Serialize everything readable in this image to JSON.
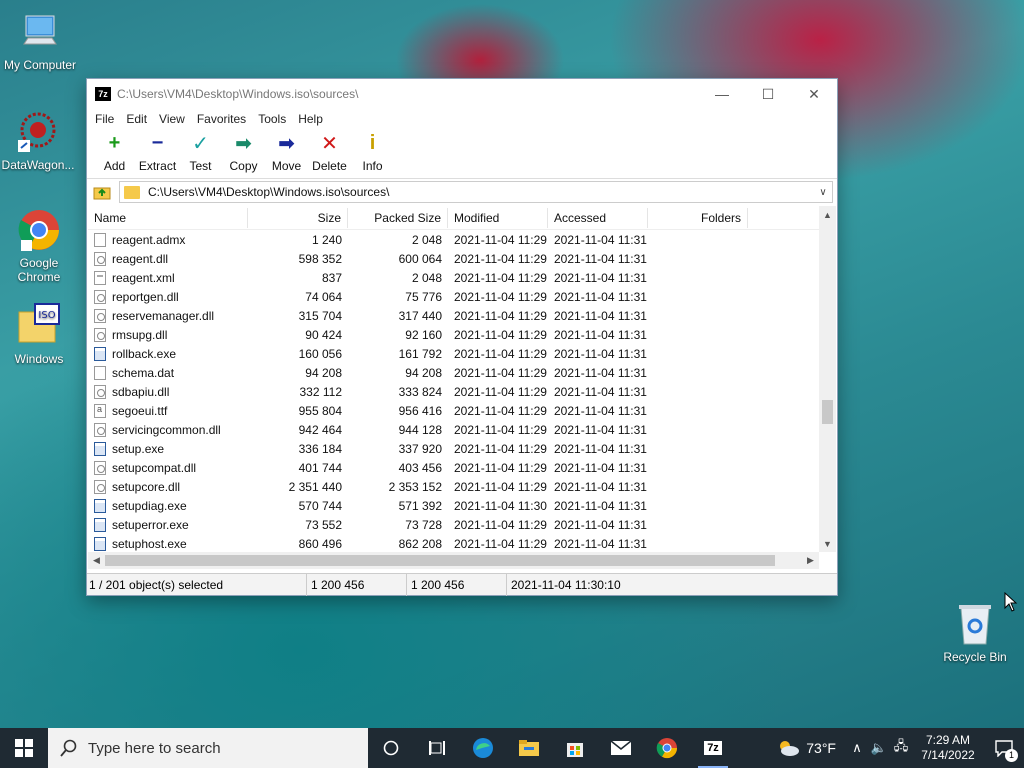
{
  "desktop": {
    "icons": [
      {
        "label": "My Computer"
      },
      {
        "label": "DataWagon..."
      },
      {
        "label": "Google Chrome"
      },
      {
        "label": "Windows"
      },
      {
        "label": "Recycle Bin"
      }
    ]
  },
  "window": {
    "title": "C:\\Users\\VM4\\Desktop\\Windows.iso\\sources\\",
    "app_icon_text": "7z",
    "menu": [
      "File",
      "Edit",
      "View",
      "Favorites",
      "Tools",
      "Help"
    ],
    "toolbar": [
      {
        "label": "Add",
        "icon": "plus-icon",
        "glyph": "+",
        "color": "#1a9a1a"
      },
      {
        "label": "Extract",
        "icon": "minus-icon",
        "glyph": "−",
        "color": "#1a2a9a"
      },
      {
        "label": "Test",
        "icon": "check-icon",
        "glyph": "✓",
        "color": "#1aa0a0"
      },
      {
        "label": "Copy",
        "icon": "copy-arrow-icon",
        "glyph": "➡",
        "color": "#1a8a6a"
      },
      {
        "label": "Move",
        "icon": "move-arrow-icon",
        "glyph": "➡",
        "color": "#1a2a9a"
      },
      {
        "label": "Delete",
        "icon": "delete-x-icon",
        "glyph": "✕",
        "color": "#d01818"
      },
      {
        "label": "Info",
        "icon": "info-icon",
        "glyph": "i",
        "color": "#c8a000"
      }
    ],
    "address": "C:\\Users\\VM4\\Desktop\\Windows.iso\\sources\\",
    "columns": [
      "Name",
      "Size",
      "Packed Size",
      "Modified",
      "Accessed",
      "Folders"
    ],
    "rows": [
      {
        "name": "reagent.admx",
        "type": "file",
        "size": "1 240",
        "packed": "2 048",
        "modified": "2021-11-04 11:29",
        "accessed": "2021-11-04 11:31"
      },
      {
        "name": "reagent.dll",
        "type": "dll",
        "size": "598 352",
        "packed": "600 064",
        "modified": "2021-11-04 11:29",
        "accessed": "2021-11-04 11:31"
      },
      {
        "name": "reagent.xml",
        "type": "xml",
        "size": "837",
        "packed": "2 048",
        "modified": "2021-11-04 11:29",
        "accessed": "2021-11-04 11:31"
      },
      {
        "name": "reportgen.dll",
        "type": "dll",
        "size": "74 064",
        "packed": "75 776",
        "modified": "2021-11-04 11:29",
        "accessed": "2021-11-04 11:31"
      },
      {
        "name": "reservemanager.dll",
        "type": "dll",
        "size": "315 704",
        "packed": "317 440",
        "modified": "2021-11-04 11:29",
        "accessed": "2021-11-04 11:31"
      },
      {
        "name": "rmsupg.dll",
        "type": "dll",
        "size": "90 424",
        "packed": "92 160",
        "modified": "2021-11-04 11:29",
        "accessed": "2021-11-04 11:31"
      },
      {
        "name": "rollback.exe",
        "type": "exe",
        "size": "160 056",
        "packed": "161 792",
        "modified": "2021-11-04 11:29",
        "accessed": "2021-11-04 11:31"
      },
      {
        "name": "schema.dat",
        "type": "file",
        "size": "94 208",
        "packed": "94 208",
        "modified": "2021-11-04 11:29",
        "accessed": "2021-11-04 11:31"
      },
      {
        "name": "sdbapiu.dll",
        "type": "dll",
        "size": "332 112",
        "packed": "333 824",
        "modified": "2021-11-04 11:29",
        "accessed": "2021-11-04 11:31"
      },
      {
        "name": "segoeui.ttf",
        "type": "ttf",
        "size": "955 804",
        "packed": "956 416",
        "modified": "2021-11-04 11:29",
        "accessed": "2021-11-04 11:31"
      },
      {
        "name": "servicingcommon.dll",
        "type": "dll",
        "size": "942 464",
        "packed": "944 128",
        "modified": "2021-11-04 11:29",
        "accessed": "2021-11-04 11:31"
      },
      {
        "name": "setup.exe",
        "type": "exe",
        "size": "336 184",
        "packed": "337 920",
        "modified": "2021-11-04 11:29",
        "accessed": "2021-11-04 11:31"
      },
      {
        "name": "setupcompat.dll",
        "type": "dll",
        "size": "401 744",
        "packed": "403 456",
        "modified": "2021-11-04 11:29",
        "accessed": "2021-11-04 11:31"
      },
      {
        "name": "setupcore.dll",
        "type": "dll",
        "size": "2 351 440",
        "packed": "2 353 152",
        "modified": "2021-11-04 11:29",
        "accessed": "2021-11-04 11:31"
      },
      {
        "name": "setupdiag.exe",
        "type": "exe",
        "size": "570 744",
        "packed": "571 392",
        "modified": "2021-11-04 11:30",
        "accessed": "2021-11-04 11:31"
      },
      {
        "name": "setuperror.exe",
        "type": "exe",
        "size": "73 552",
        "packed": "73 728",
        "modified": "2021-11-04 11:29",
        "accessed": "2021-11-04 11:31"
      },
      {
        "name": "setuphost.exe",
        "type": "exe",
        "size": "860 496",
        "packed": "862 208",
        "modified": "2021-11-04 11:29",
        "accessed": "2021-11-04 11:31"
      }
    ],
    "status": {
      "selection": "1 / 201 object(s) selected",
      "size": "1 200 456",
      "packed": "1 200 456",
      "modified": "2021-11-04 11:30:10"
    }
  },
  "taskbar": {
    "search_placeholder": "Type here to search",
    "weather_temp": "73°F",
    "time": "7:29 AM",
    "date": "7/14/2022",
    "notification_count": "1",
    "app_7z_label": "7z"
  }
}
